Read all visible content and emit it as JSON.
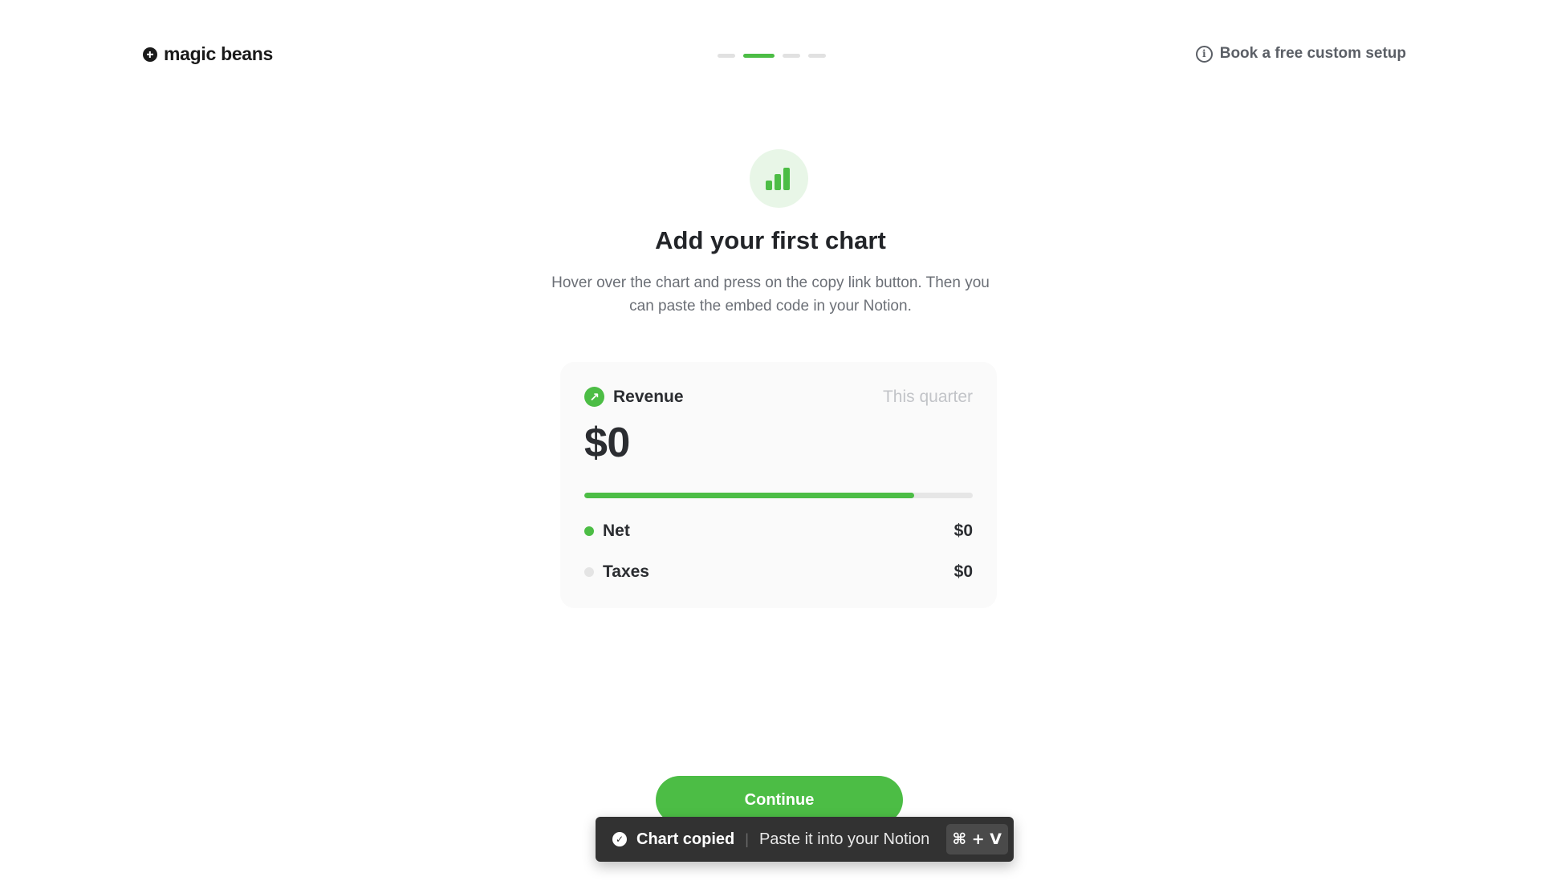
{
  "header": {
    "brand": "magic beans",
    "steps": [
      {
        "active": false
      },
      {
        "active": true
      },
      {
        "active": false
      },
      {
        "active": false
      }
    ],
    "setup_link": "Book a free custom setup",
    "info_icon": "i"
  },
  "hero": {
    "icon": "bar-chart-icon",
    "title": "Add your first chart",
    "subtitle": "Hover over the chart and press on the copy link button. Then you can paste the embed code in your Notion."
  },
  "card": {
    "label": "Revenue",
    "period": "This quarter",
    "value": "$0",
    "progress_fraction": 0.85,
    "legend": [
      {
        "label": "Net",
        "value": "$0",
        "color": "#4cbd45"
      },
      {
        "label": "Taxes",
        "value": "$0",
        "color": "#e4e4e4"
      }
    ]
  },
  "actions": {
    "continue_label": "Continue"
  },
  "toast": {
    "title": "Chart copied",
    "separator": "|",
    "message": "Paste it into your Notion",
    "shortcut": "⌘ + V"
  },
  "colors": {
    "accent": "#4cbd45",
    "toast_bg": "#323232"
  }
}
